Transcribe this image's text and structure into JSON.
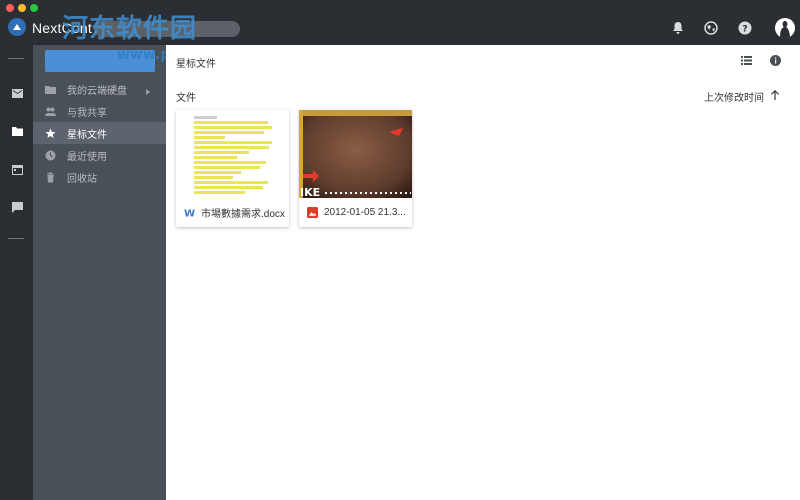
{
  "app": {
    "name": "NextCont"
  },
  "watermark": {
    "text": "河东软件园",
    "url": "www.pc0359.cn"
  },
  "sidebar": {
    "items": [
      {
        "label": "我的云端硬盘",
        "icon": "drive-icon"
      },
      {
        "label": "与我共享",
        "icon": "people-icon"
      },
      {
        "label": "星标文件",
        "icon": "star-icon",
        "active": true
      },
      {
        "label": "最近使用",
        "icon": "clock-icon"
      },
      {
        "label": "回收站",
        "icon": "trash-icon"
      }
    ]
  },
  "main": {
    "breadcrumb": "星标文件",
    "section_title": "文件",
    "sort_label": "上次修改时间",
    "files": [
      {
        "name": "市場數據需求.docx",
        "type": "word-doc-icon"
      },
      {
        "name": "2012-01-05 21.3...",
        "type": "image-file-icon"
      }
    ]
  },
  "colors": {
    "titlebar": "#2b2e33",
    "sidebar": "#4a5058",
    "sidebar_active": "#5d646d",
    "accent": "#4a8fd8",
    "image_accent": "#e8382b"
  }
}
